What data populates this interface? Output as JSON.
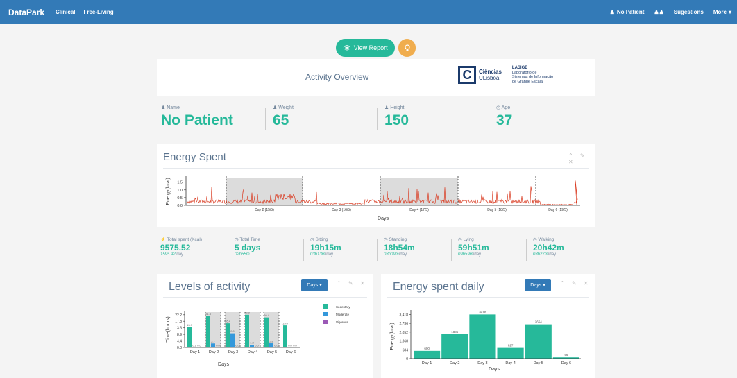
{
  "navbar": {
    "brand": "DataPark",
    "links": [
      "Clinical",
      "Free-Living"
    ],
    "patient": "No Patient",
    "users_icon": "users-icon",
    "sugestions": "Sugestions",
    "more": "More"
  },
  "actions": {
    "view_report": "View Report",
    "bulb_icon": "lightbulb-icon"
  },
  "overview": {
    "title": "Activity Overview",
    "logo": {
      "letter": "C",
      "line1": "Ciências",
      "line2": "ULisboa",
      "lasige_title": "LASIGE",
      "lasige_1": "Laboratório de",
      "lasige_2": "Sistemas de Informação",
      "lasige_3": "de Grande Escala"
    }
  },
  "patient": [
    {
      "label": "Name",
      "icon": "user-icon",
      "value": "No Patient"
    },
    {
      "label": "Weight",
      "icon": "user-icon",
      "value": "65"
    },
    {
      "label": "Height",
      "icon": "user-icon",
      "value": "150"
    },
    {
      "label": "Age",
      "icon": "clock-icon",
      "value": "37"
    }
  ],
  "energy_panel": {
    "title": "Energy Spent",
    "tools": "⌃ ✎ ✕"
  },
  "tiles": [
    {
      "label": "Total spent (Kcal)",
      "icon": "bolt-icon",
      "value": "9575.52",
      "sub_em": "1595.92",
      "sub_rest": "/day"
    },
    {
      "label": "Total Time",
      "icon": "clock-icon",
      "value": "5 days",
      "sub_em": "02h55m",
      "sub_rest": ""
    },
    {
      "label": "Sitting",
      "icon": "clock-icon",
      "value": "19h15m",
      "sub_em": "03h13m",
      "sub_rest": "/day"
    },
    {
      "label": "Standing",
      "icon": "clock-icon",
      "value": "18h54m",
      "sub_em": "03h09m",
      "sub_rest": "/day"
    },
    {
      "label": "Lying",
      "icon": "clock-icon",
      "value": "59h51m",
      "sub_em": "09h59m",
      "sub_rest": "/day"
    },
    {
      "label": "Walking",
      "icon": "clock-icon",
      "value": "20h42m",
      "sub_em": "03h27m",
      "sub_rest": "/day"
    }
  ],
  "levels_panel": {
    "title": "Levels of activity",
    "days_button": "Days",
    "tools": "⌃ ✎ ✕"
  },
  "daily_panel": {
    "title": "Energy spent daily",
    "days_button": "Days",
    "tools": "⌃ ✎ ✕"
  },
  "chart_data": [
    {
      "type": "line",
      "title": "",
      "xlabel": "Days",
      "ylabel": "Energy(kcal)",
      "yticks": [
        "0.0",
        "0.5",
        "1.0",
        "1.5"
      ],
      "ylim": [
        0,
        1.8
      ],
      "x_tick_labels": [
        "Day 2 (15/5)",
        "Day 3 (16/5)",
        "Day 4 (17/5)",
        "Day 5 (18/5)",
        "Day 6 (19/5)"
      ],
      "shaded_days": [
        "Day 2 (15/5)",
        "Day 4 (17/5)"
      ],
      "color": "#d9381e"
    },
    {
      "type": "bar",
      "title": "",
      "xlabel": "Days",
      "ylabel": "Time(hours)",
      "categories": [
        "Day 1",
        "Day 2",
        "Day 3",
        "Day 4",
        "Day 5",
        "Day 6"
      ],
      "yticks": [
        "0.0",
        "4.4",
        "8.9",
        "13.3",
        "17.8",
        "22.2"
      ],
      "ylim": [
        0,
        24
      ],
      "series": [
        {
          "name": "Sedentary",
          "color": "#26b99a",
          "values": [
            13.9,
            21.3,
            16.4,
            22.2,
            20.4,
            15.0
          ],
          "labels": [
            "13.9",
            "21.3",
            "16.4",
            "22.2",
            "20.4",
            "15.0"
          ]
        },
        {
          "name": "Moderate",
          "color": "#3498db",
          "values": [
            0.1,
            2.7,
            9.6,
            1.8,
            2.8,
            0.0
          ],
          "labels": [
            "0.1",
            "2.7",
            "9.6",
            "1.8",
            "2.8",
            "0.0"
          ]
        },
        {
          "name": "Vigorous",
          "color": "#9b59b6",
          "values": [
            0.0,
            0.0,
            0.0,
            0.0,
            0.0,
            0.0
          ],
          "labels": [
            "0.0",
            "0.0",
            "0.0",
            "0.0",
            "0.0",
            "0.0"
          ]
        }
      ]
    },
    {
      "type": "bar",
      "title": "",
      "xlabel": "Days",
      "ylabel": "Energy(kcal)",
      "categories": [
        "Day 1",
        "Day 2",
        "Day 3",
        "Day 4",
        "Day 5",
        "Day 6"
      ],
      "yticks": [
        "0",
        "684",
        "1,368",
        "2,052",
        "2,736",
        "3,418"
      ],
      "ylim": [
        0,
        3600
      ],
      "values": [
        600,
        1885,
        3418,
        827,
        2654,
        96
      ],
      "labels": [
        "600",
        "1885",
        "3418",
        "827",
        "2654",
        "96"
      ],
      "color": "#26b99a"
    }
  ]
}
